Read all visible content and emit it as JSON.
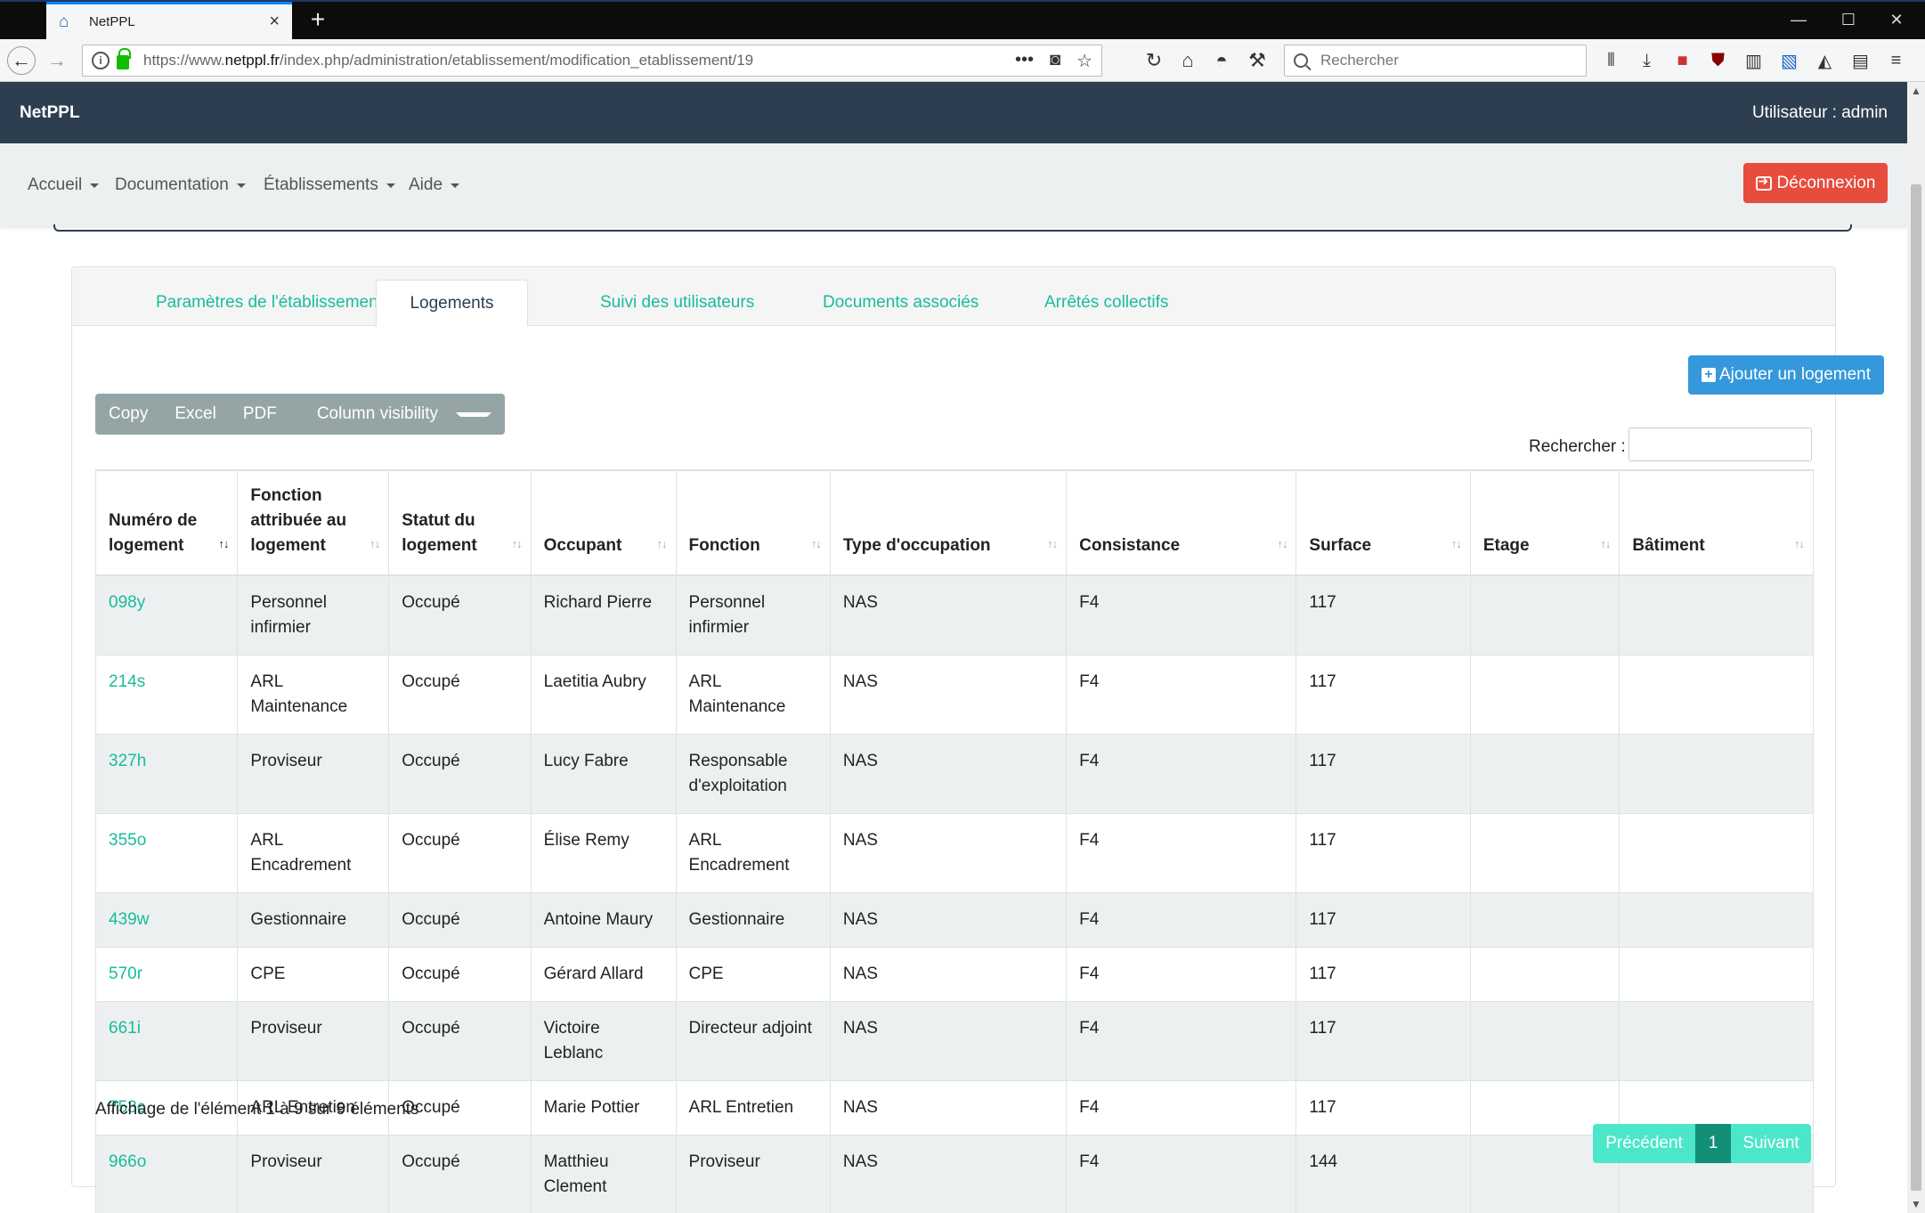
{
  "browser": {
    "tab_title": "NetPPL",
    "url_prefix": "https://www.",
    "url_domain": "netppl.fr",
    "url_path": "/index.php/administration/etablissement/modification_etablissement/19",
    "search_placeholder": "Rechercher"
  },
  "app": {
    "brand": "NetPPL",
    "user_label": "Utilisateur : admin"
  },
  "menu": {
    "items": [
      "Accueil",
      "Documentation",
      "Établissements",
      "Aide"
    ],
    "logout_label": "Déconnexion"
  },
  "tabs": [
    "Paramètres de l'établissement",
    "Logements",
    "Suivi des utilisateurs",
    "Documents associés",
    "Arrêtés collectifs"
  ],
  "toolbar": {
    "add_label": "Ajouter un logement",
    "buttons": [
      "Copy",
      "Excel",
      "PDF",
      "Column visibility"
    ],
    "search_label": "Rechercher :"
  },
  "table": {
    "headers": [
      "Numéro de logement",
      "Fonction attribuée au logement",
      "Statut du logement",
      "Occupant",
      "Fonction",
      "Type d'occupation",
      "Consistance",
      "Surface",
      "Etage",
      "Bâtiment"
    ],
    "rows": [
      [
        "098y",
        "Personnel infirmier",
        "Occupé",
        "Richard Pierre",
        "Personnel infirmier",
        "NAS",
        "F4",
        "117",
        "",
        ""
      ],
      [
        "214s",
        "ARL Maintenance",
        "Occupé",
        "Laetitia Aubry",
        "ARL Maintenance",
        "NAS",
        "F4",
        "117",
        "",
        ""
      ],
      [
        "327h",
        "Proviseur",
        "Occupé",
        "Lucy Fabre",
        "Responsable d'exploitation",
        "NAS",
        "F4",
        "117",
        "",
        ""
      ],
      [
        "355o",
        "ARL Encadrement",
        "Occupé",
        "Élise Remy",
        "ARL Encadrement",
        "NAS",
        "F4",
        "117",
        "",
        ""
      ],
      [
        "439w",
        "Gestionnaire",
        "Occupé",
        "Antoine Maury",
        "Gestionnaire",
        "NAS",
        "F4",
        "117",
        "",
        ""
      ],
      [
        "570r",
        "CPE",
        "Occupé",
        "Gérard Allard",
        "CPE",
        "NAS",
        "F4",
        "117",
        "",
        ""
      ],
      [
        "661i",
        "Proviseur",
        "Occupé",
        "Victoire Leblanc",
        "Directeur adjoint",
        "NAS",
        "F4",
        "117",
        "",
        ""
      ],
      [
        "753c",
        "ARL Entretien",
        "Occupé",
        "Marie Pottier",
        "ARL Entretien",
        "NAS",
        "F4",
        "117",
        "",
        ""
      ],
      [
        "966o",
        "Proviseur",
        "Occupé",
        "Matthieu Clement",
        "Proviseur",
        "NAS",
        "F4",
        "144",
        "",
        ""
      ]
    ]
  },
  "footer": {
    "info": "Affichage de l'élément 1 à 9 sur 9 éléments",
    "prev": "Précédent",
    "page": "1",
    "next": "Suivant"
  }
}
